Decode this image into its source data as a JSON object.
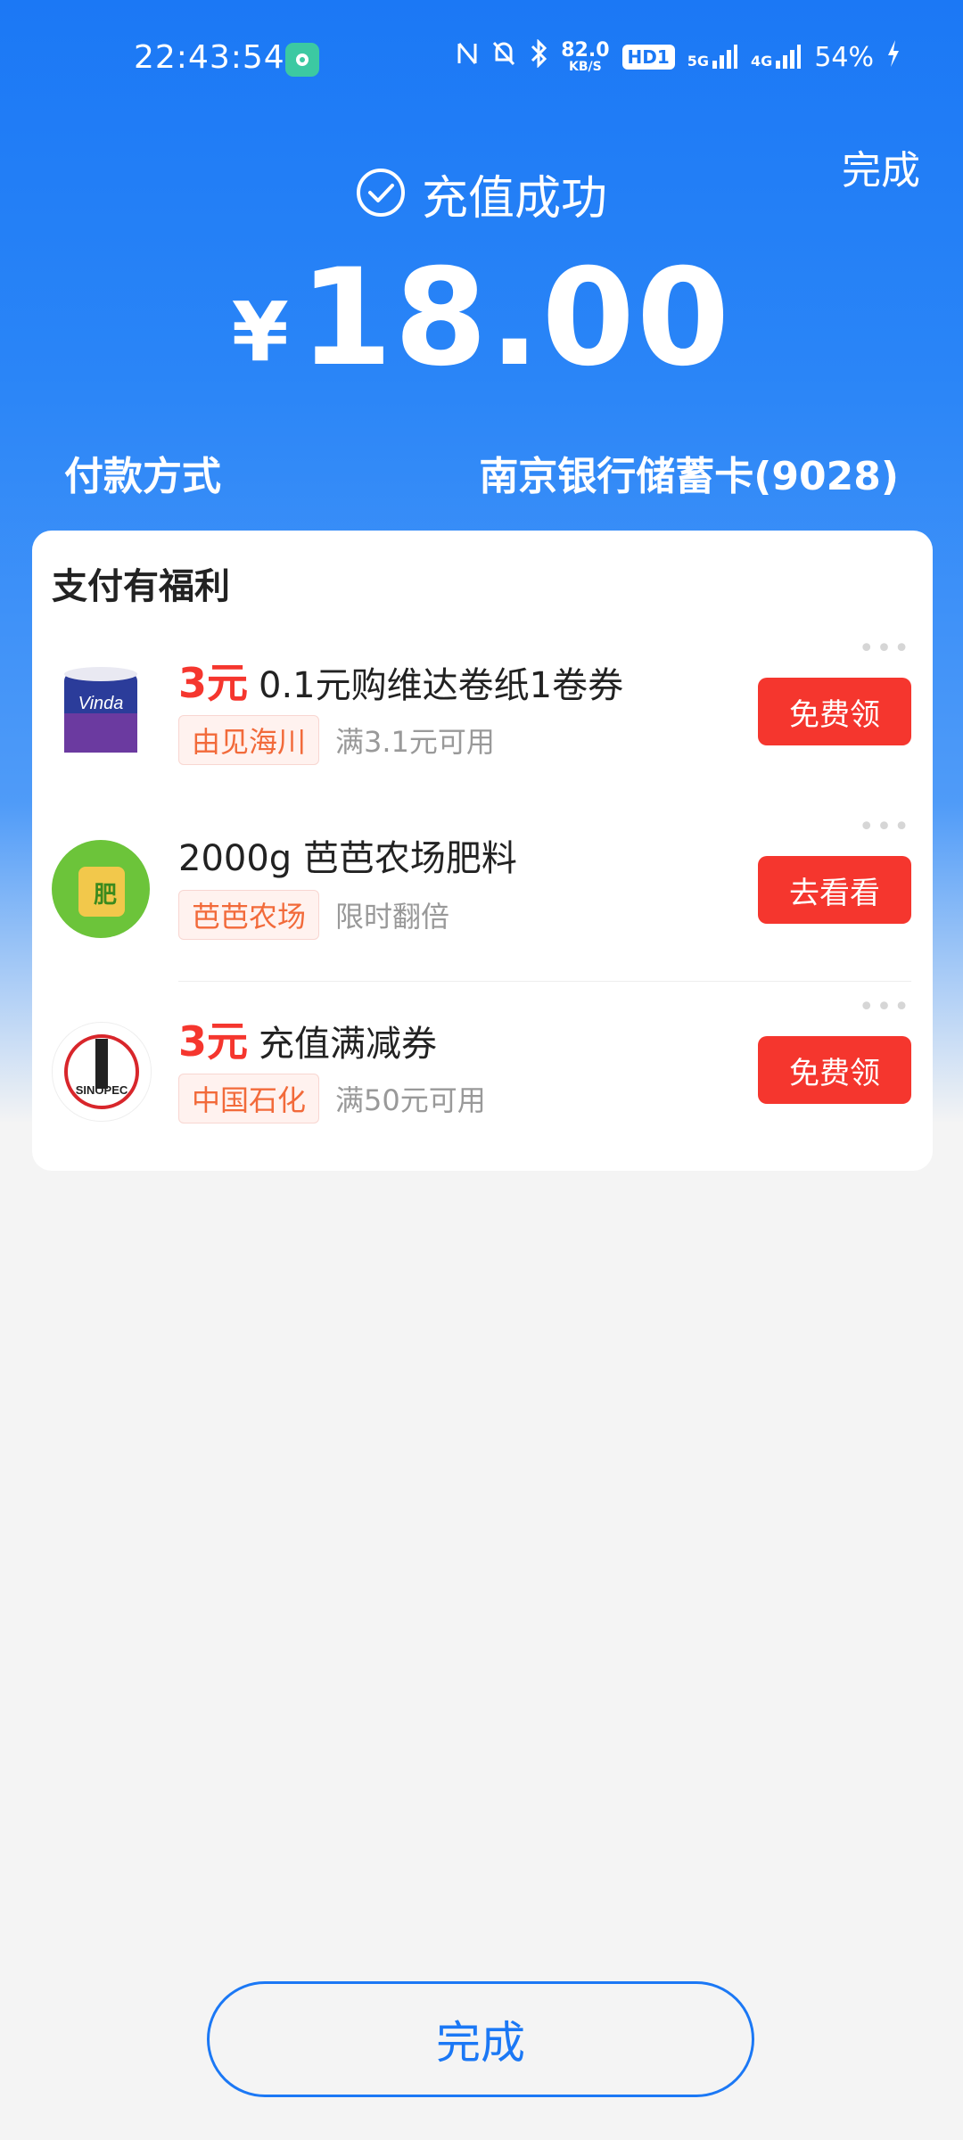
{
  "status_bar": {
    "time": "22:43:54",
    "speed_value": "82.0",
    "speed_unit": "KB/S",
    "hd_badge": "HD1",
    "network_5g": "5G",
    "network_4g": "4G",
    "battery": "54%"
  },
  "header": {
    "done_label": "完成",
    "success_text": "充值成功",
    "currency_symbol": "¥",
    "amount": "18.00",
    "payment_method_label": "付款方式",
    "payment_method_value": "南京银行储蓄卡(9028)"
  },
  "benefits": {
    "title": "支付有福利",
    "items": [
      {
        "price": "3元",
        "headline": "0.1元购维达卷纸1卷券",
        "tag": "由见海川",
        "note": "满3.1元可用",
        "button": "免费领",
        "thumb_text": "Vinda"
      },
      {
        "price": "",
        "headline": "2000g 芭芭农场肥料",
        "tag": "芭芭农场",
        "note": "限时翻倍",
        "button": "去看看",
        "thumb_text": "肥"
      },
      {
        "price": "3元",
        "headline": "充值满减券",
        "tag": "中国石化",
        "note": "满50元可用",
        "button": "免费领",
        "thumb_text": "SINOPEC"
      }
    ]
  },
  "footer": {
    "done_button": "完成"
  },
  "colors": {
    "primary_blue": "#1b78f5",
    "accent_red": "#f5362e",
    "tag_orange": "#f26a3a"
  }
}
